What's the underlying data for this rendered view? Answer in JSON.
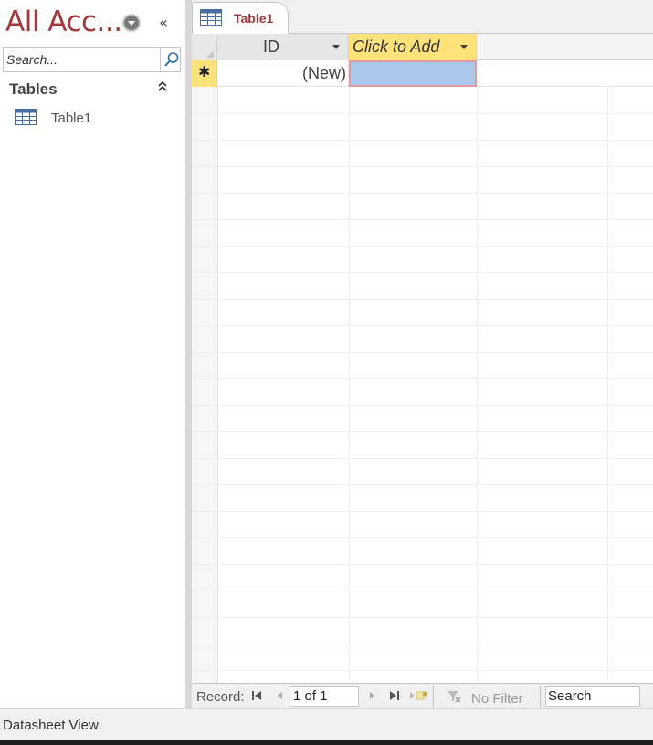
{
  "nav_pane": {
    "title": "All Acc...",
    "search_placeholder": "Search...",
    "group_label": "Tables",
    "items": [
      {
        "label": "Table1",
        "icon": "table-icon"
      }
    ]
  },
  "document_tab": {
    "label": "Table1",
    "icon": "table-icon"
  },
  "datasheet": {
    "columns": [
      {
        "label": "ID"
      },
      {
        "label": "Click to Add"
      }
    ],
    "new_row": {
      "selector_symbol": "✱",
      "id_value": "(New)"
    }
  },
  "record_nav": {
    "label": "Record:",
    "current": "1 of 1",
    "filter_label": "No Filter",
    "search_value": "Search"
  },
  "status_bar": {
    "text": "Datasheet View"
  },
  "colors": {
    "accent": "#a4373a",
    "header_highlight": "#ffe27a",
    "selected_cell": "#a9c8ec"
  }
}
